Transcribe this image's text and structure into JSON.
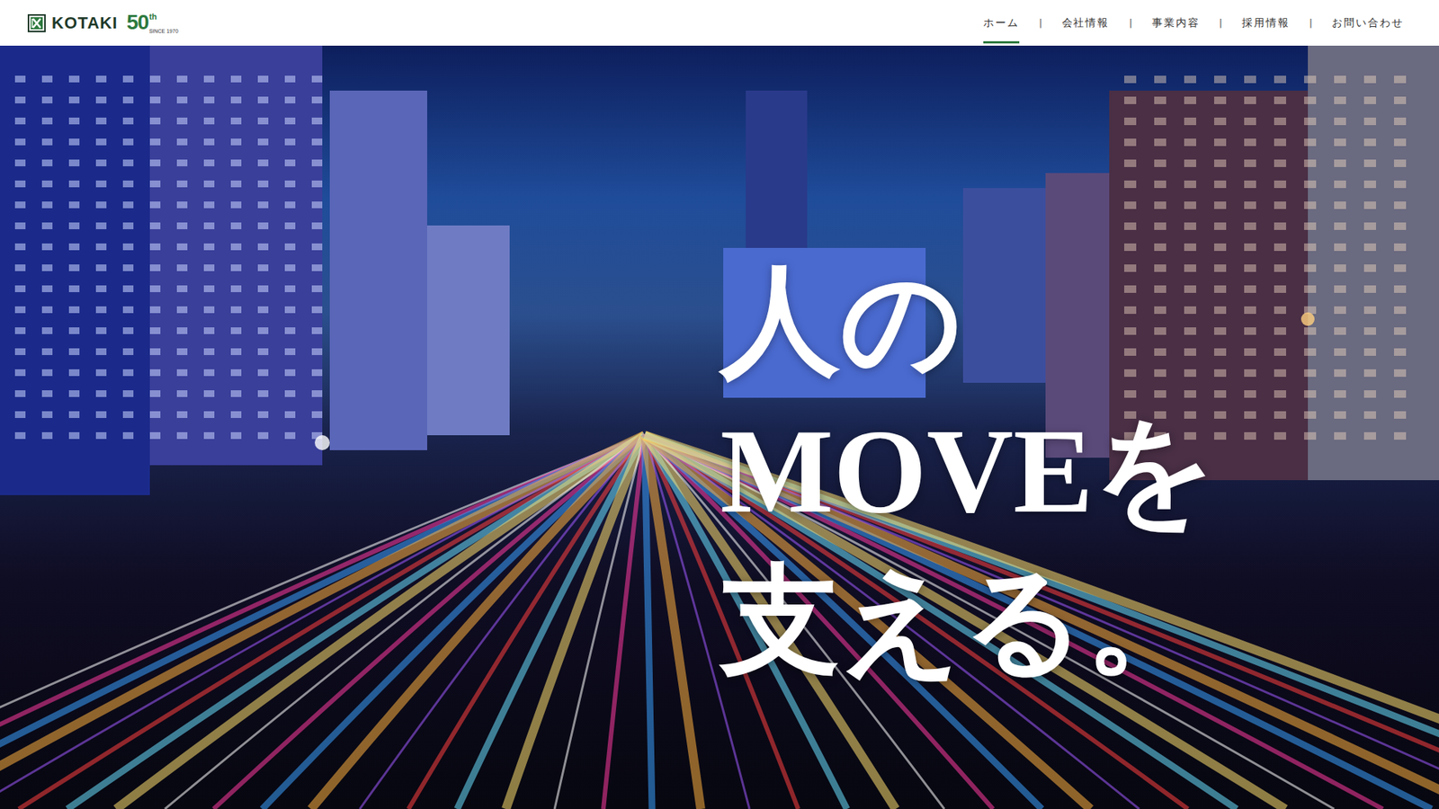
{
  "header": {
    "logo": {
      "name": "KOTAKI",
      "anniversary": "50",
      "suffix": "th",
      "since": "SINCE 1970"
    },
    "nav": [
      {
        "label": "ホーム",
        "selected": true
      },
      {
        "label": "会社情報",
        "selected": false
      },
      {
        "label": "事業内容",
        "selected": false
      },
      {
        "label": "採用情報",
        "selected": false
      },
      {
        "label": "お問い合わせ",
        "selected": false
      }
    ],
    "separator": "|"
  },
  "hero": {
    "headline": [
      "人の",
      "MOVEを",
      "支える。"
    ]
  }
}
